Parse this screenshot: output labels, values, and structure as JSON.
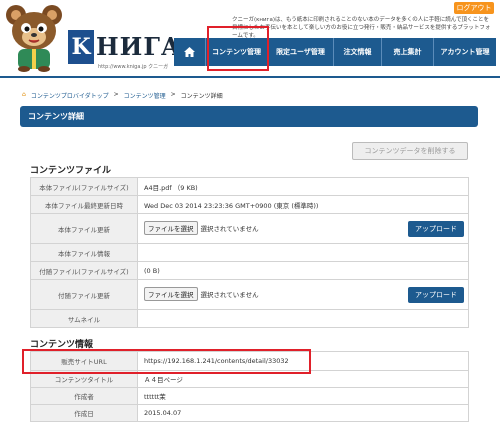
{
  "header": {
    "logout_label": "ログアウト",
    "tagline": "クニーガ(κнига)は、もう紙本に印刷されることのない本のデータを多くの人に手軽に読んで頂くことを目標にしたお手伝いを本として楽しい方のお役に立つ発行・販売・納品サービスを提供するプラットフォームです。",
    "logo_letter": "K",
    "logo_text": "НИГА.",
    "logo_url": "http://www.kniga.jp クニーガ"
  },
  "nav": {
    "items": [
      {
        "label": "コンテンツ管理"
      },
      {
        "label": "限定ユーザ管理"
      },
      {
        "label": "注文情報"
      },
      {
        "label": "売上集計"
      },
      {
        "label": "アカウント管理"
      }
    ]
  },
  "breadcrumb": {
    "items": [
      "コンテンツプロバイダトップ",
      ">",
      "コンテンツ管理",
      ">",
      "コンテンツ詳細"
    ]
  },
  "page_title": "コンテンツ詳細",
  "file_section": {
    "title": "コンテンツファイル",
    "delete_label": "コンテンツデータを削除する",
    "rows": {
      "main_size": {
        "label": "本体ファイル(ファイルサイズ)",
        "value": "A4目.pdf （9 KB)"
      },
      "main_updated": {
        "label": "本体ファイル最終更新日時",
        "value": "Wed Dec 03 2014 23:23:36 GMT+0900 (東京 (標準時))"
      },
      "main_update": {
        "label": "本体ファイル更新",
        "file_button": "ファイルを選択",
        "file_status": "選択されていません",
        "upload_label": "アップロード"
      },
      "main_info": {
        "label": "本体ファイル情報",
        "value": ""
      },
      "attach_size": {
        "label": "付随ファイル(ファイルサイズ)",
        "value": "(0 B)"
      },
      "attach_update": {
        "label": "付随ファイル更新",
        "file_button": "ファイルを選択",
        "file_status": "選択されていません",
        "upload_label": "アップロード"
      },
      "thumbnail": {
        "label": "サムネイル",
        "value": ""
      }
    }
  },
  "info_section": {
    "title": "コンテンツ情報",
    "rows": {
      "sales_url": {
        "label": "販売サイトURL",
        "value": "https://192.168.1.241/contents/detail/33032"
      },
      "content_title": {
        "label": "コンテンツタイトル",
        "value": "Ａ４目ページ"
      },
      "author": {
        "label": "作成者",
        "value": "tttttt茉"
      },
      "created": {
        "label": "作成日",
        "value": "2015.04.07"
      }
    }
  },
  "colors": {
    "primary": "#1d5a8f",
    "accent": "#f7941d",
    "highlight": "#e0202a"
  }
}
